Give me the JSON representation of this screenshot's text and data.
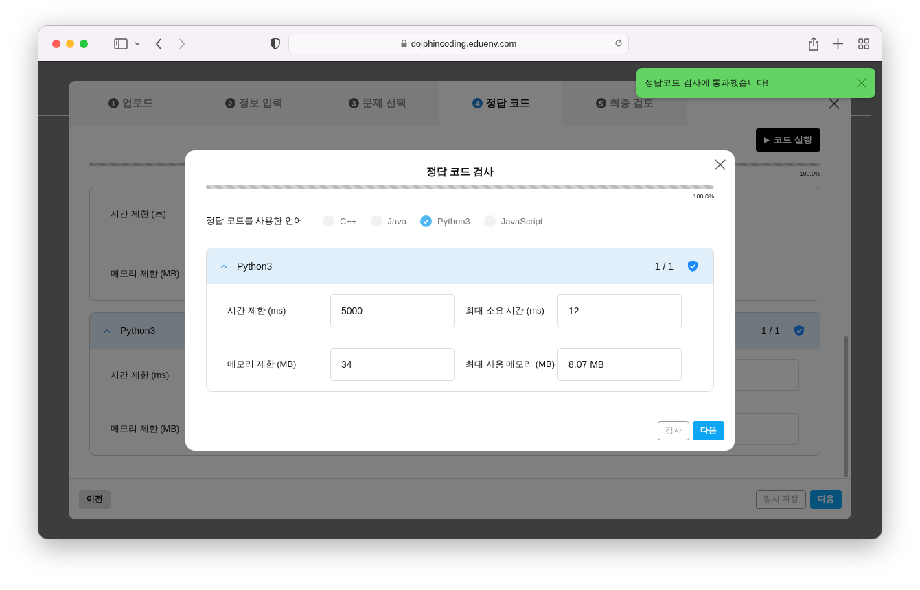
{
  "browser": {
    "url": "dolphincoding.eduenv.com"
  },
  "toast": {
    "message": "정답코드 검사에 통과했습니다!"
  },
  "wizard": {
    "steps": [
      {
        "number": "1",
        "label": "업로드",
        "selected": false
      },
      {
        "number": "2",
        "label": "정보 입력",
        "selected": false
      },
      {
        "number": "3",
        "label": "문제 선택",
        "selected": false
      },
      {
        "number": "4",
        "label": "정답 코드",
        "selected": true
      },
      {
        "number": "5",
        "label": "최종 검토",
        "selected": false
      }
    ],
    "run_button": "코드 실행",
    "progress": {
      "level": 1,
      "reading": "100.0%"
    },
    "limits_card": {
      "rows": [
        {
          "label": "시간 제한 (초)"
        },
        {
          "label": "메모리 제한 (MB)"
        }
      ]
    },
    "language_section": {
      "name": "Python3",
      "expanded": true,
      "score": "1 / 1",
      "rows": [
        {
          "label": "시간 제한 (ms)"
        },
        {
          "label": "메모리 제한 (MB)"
        }
      ]
    },
    "prev_button": "이전",
    "save_button": "임시 저장",
    "next_button": "다음"
  },
  "dialog": {
    "title": "정답 코드 검사",
    "progress": {
      "level": 1,
      "reading": "100.0%"
    },
    "language_label": "정답 코드를 사용한 언어",
    "languages": [
      {
        "label": "C++",
        "selected": false
      },
      {
        "label": "Java",
        "selected": false
      },
      {
        "label": "Python3",
        "selected": true
      },
      {
        "label": "JavaScript",
        "selected": false
      }
    ],
    "section": {
      "name": "Python3",
      "expanded": true,
      "score": "1 / 1",
      "fields": [
        {
          "label": "시간 제한 (ms)",
          "value": "5000"
        },
        {
          "label": "최대 소요 시간 (ms)",
          "value": "12"
        },
        {
          "label": "메모리 제한 (MB)",
          "value": "34"
        },
        {
          "label": "최대 사용 메모리 (MB)",
          "value": "8.07 MB"
        }
      ]
    },
    "buttons": [
      {
        "label": "검사",
        "disabled": true
      },
      {
        "label": "다음",
        "disabled": false
      }
    ]
  }
}
